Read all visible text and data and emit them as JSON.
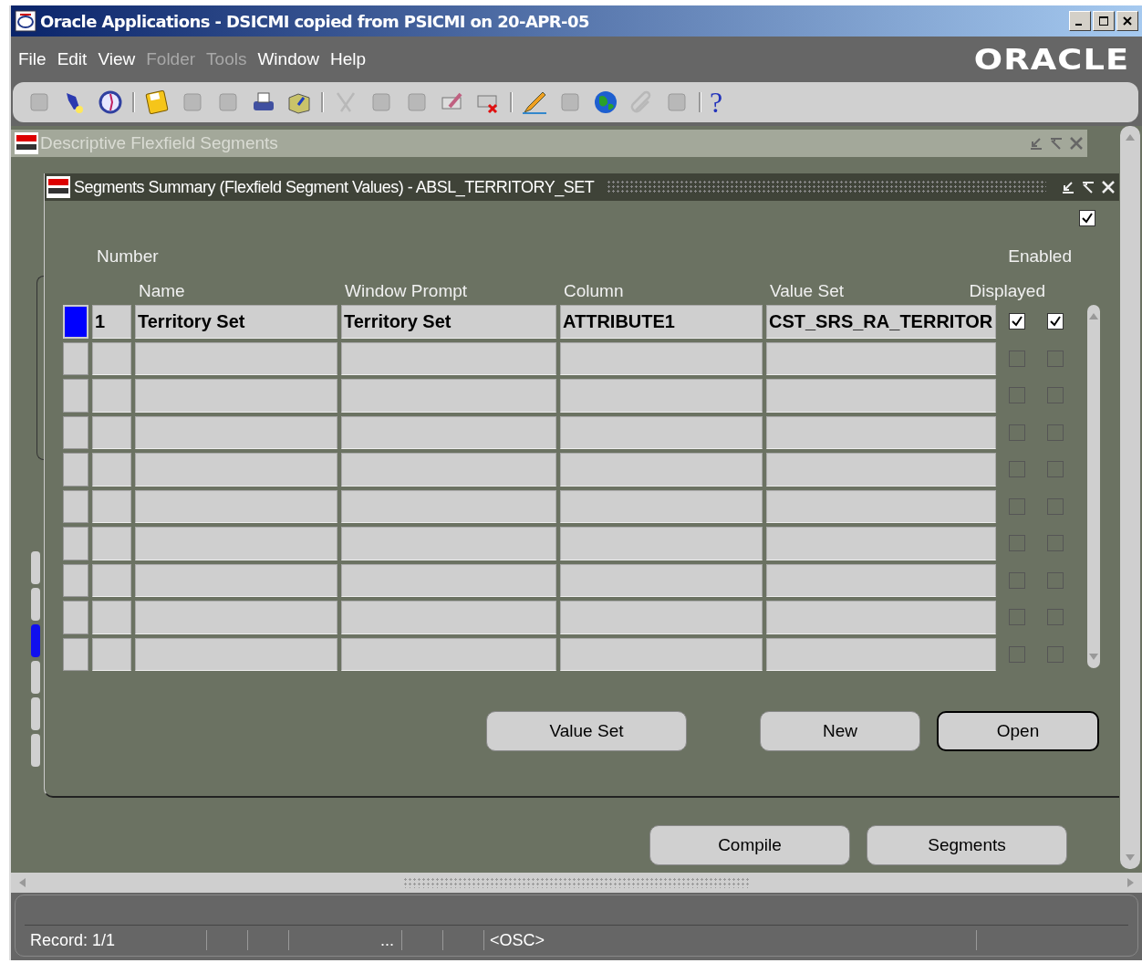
{
  "window": {
    "title": "Oracle Applications - DSICMI copied from PSICMI on 20-APR-05"
  },
  "menu": [
    {
      "label": "File",
      "disabled": false
    },
    {
      "label": "Edit",
      "disabled": false
    },
    {
      "label": "View",
      "disabled": false
    },
    {
      "label": "Folder",
      "disabled": true
    },
    {
      "label": "Tools",
      "disabled": true
    },
    {
      "label": "Window",
      "disabled": false
    },
    {
      "label": "Help",
      "disabled": false
    }
  ],
  "logo": "ORACLE",
  "toolbar": [
    {
      "kind": "new",
      "disabled": true
    },
    {
      "kind": "find",
      "disabled": false
    },
    {
      "kind": "navigator",
      "disabled": false
    },
    {
      "kind": "separator"
    },
    {
      "kind": "save",
      "disabled": false
    },
    {
      "kind": "next",
      "disabled": true
    },
    {
      "kind": "switch",
      "disabled": true
    },
    {
      "kind": "print",
      "disabled": false
    },
    {
      "kind": "close",
      "disabled": false
    },
    {
      "kind": "separator"
    },
    {
      "kind": "cut",
      "disabled": true
    },
    {
      "kind": "copy",
      "disabled": true
    },
    {
      "kind": "paste",
      "disabled": true
    },
    {
      "kind": "clear",
      "disabled": false
    },
    {
      "kind": "delete",
      "disabled": false
    },
    {
      "kind": "separator"
    },
    {
      "kind": "edit",
      "disabled": false
    },
    {
      "kind": "zoom",
      "disabled": true
    },
    {
      "kind": "globe",
      "disabled": false
    },
    {
      "kind": "attach",
      "disabled": true
    },
    {
      "kind": "folder-tools",
      "disabled": true
    },
    {
      "kind": "separator"
    },
    {
      "kind": "help",
      "label": "?",
      "disabled": false
    }
  ],
  "background_window": {
    "title": "Descriptive Flexfield Segments"
  },
  "dialog": {
    "title": "Segments Summary (Flexfield Segment Values) - ABSL_TERRITORY_SET",
    "header_checkbox": {
      "checked": true
    },
    "columns": {
      "number": "Number",
      "name": "Name",
      "prompt": "Window Prompt",
      "column": "Column",
      "value_set": "Value Set",
      "displayed": "Displayed",
      "enabled": "Enabled"
    },
    "rows": [
      {
        "current": true,
        "number": "1",
        "name": "Territory Set",
        "prompt": "Territory Set",
        "column": "ATTRIBUTE1",
        "value_set": "CST_SRS_RA_TERRITOR",
        "displayed": true,
        "enabled": true
      },
      {
        "current": false,
        "displayed": false,
        "enabled": false
      },
      {
        "current": false,
        "displayed": false,
        "enabled": false
      },
      {
        "current": false,
        "displayed": false,
        "enabled": false
      },
      {
        "current": false,
        "displayed": false,
        "enabled": false
      },
      {
        "current": false,
        "displayed": false,
        "enabled": false
      },
      {
        "current": false,
        "displayed": false,
        "enabled": false
      },
      {
        "current": false,
        "displayed": false,
        "enabled": false
      },
      {
        "current": false,
        "displayed": false,
        "enabled": false
      },
      {
        "current": false,
        "displayed": false,
        "enabled": false
      }
    ],
    "buttons": [
      {
        "label": "Value Set",
        "default": false
      },
      {
        "label": "New",
        "default": false
      },
      {
        "label": "Open",
        "default": true
      }
    ]
  },
  "side_tabs": [
    {
      "selected": false
    },
    {
      "selected": false
    },
    {
      "selected": true
    },
    {
      "selected": false
    },
    {
      "selected": false
    },
    {
      "selected": false
    }
  ],
  "form_buttons": [
    "Compile",
    "Segments"
  ],
  "status_bar": [
    "Record: 1/1",
    "...",
    "<OSC>"
  ]
}
